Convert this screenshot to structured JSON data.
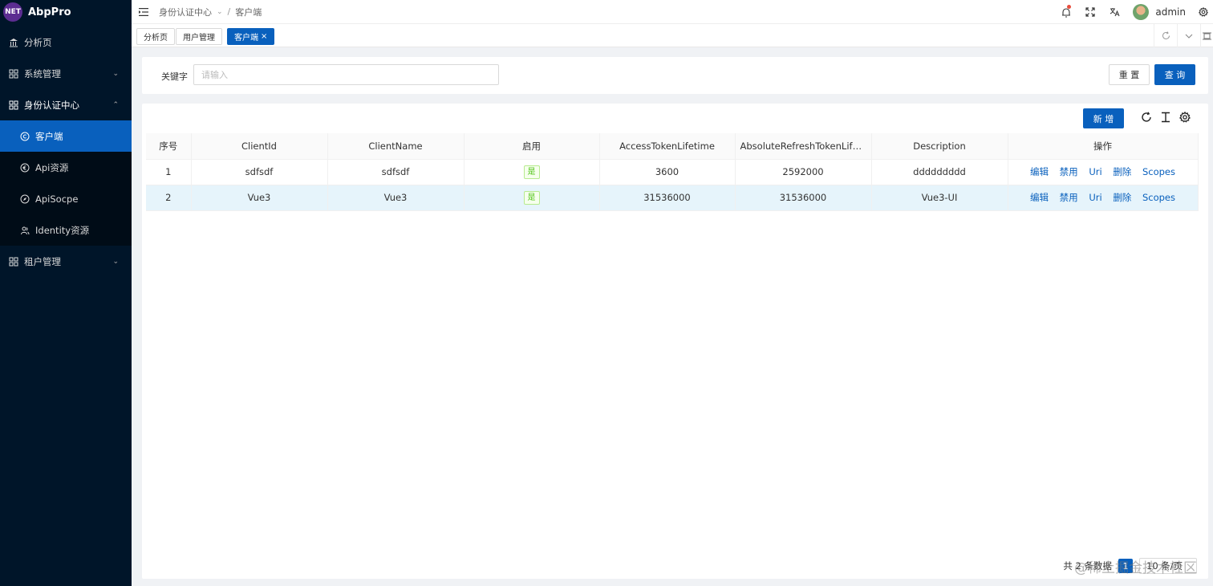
{
  "app": {
    "logo_badge": "NET",
    "name": "AbpPro"
  },
  "sidebar": {
    "items": [
      {
        "label": "分析页",
        "icon": "bank-icon"
      },
      {
        "label": "系统管理",
        "icon": "grid-icon"
      },
      {
        "label": "身份认证中心",
        "icon": "grid-icon"
      },
      {
        "label": "租户管理",
        "icon": "grid-icon"
      }
    ],
    "sub": [
      {
        "label": "客户端",
        "icon": "copyright-icon"
      },
      {
        "label": "Api资源",
        "icon": "euro-icon"
      },
      {
        "label": "ApiSocpe",
        "icon": "compass-icon"
      },
      {
        "label": "Identity资源",
        "icon": "user-group-icon"
      }
    ]
  },
  "header": {
    "breadcrumb": [
      "身份认证中心",
      "客户端"
    ],
    "user": "admin"
  },
  "tabs": [
    "分析页",
    "用户管理",
    "客户端"
  ],
  "search": {
    "label": "关键字",
    "placeholder": "请输入",
    "reset": "重 置",
    "query": "查 询"
  },
  "table": {
    "add_label": "新 增",
    "columns": [
      "序号",
      "ClientId",
      "ClientName",
      "启用",
      "AccessTokenLifetime",
      "AbsoluteRefreshTokenLifetime",
      "Description",
      "操作"
    ],
    "rows": [
      {
        "no": "1",
        "client_id": "sdfsdf",
        "client_name": "sdfsdf",
        "enabled": "是",
        "access": "3600",
        "refresh": "2592000",
        "desc": "ddddddddd"
      },
      {
        "no": "2",
        "client_id": "Vue3",
        "client_name": "Vue3",
        "enabled": "是",
        "access": "31536000",
        "refresh": "31536000",
        "desc": "Vue3-UI"
      }
    ],
    "actions": [
      "编辑",
      "禁用",
      "Uri",
      "删除",
      "Scopes"
    ]
  },
  "pager": {
    "total": "共 2 条数据",
    "page": "1",
    "size": "10 条/页"
  },
  "watermark": "@稀土掘金技术社区",
  "colors": {
    "primary": "#0960bd",
    "sidebar": "#001529",
    "sidebar_sub": "#000c17"
  }
}
